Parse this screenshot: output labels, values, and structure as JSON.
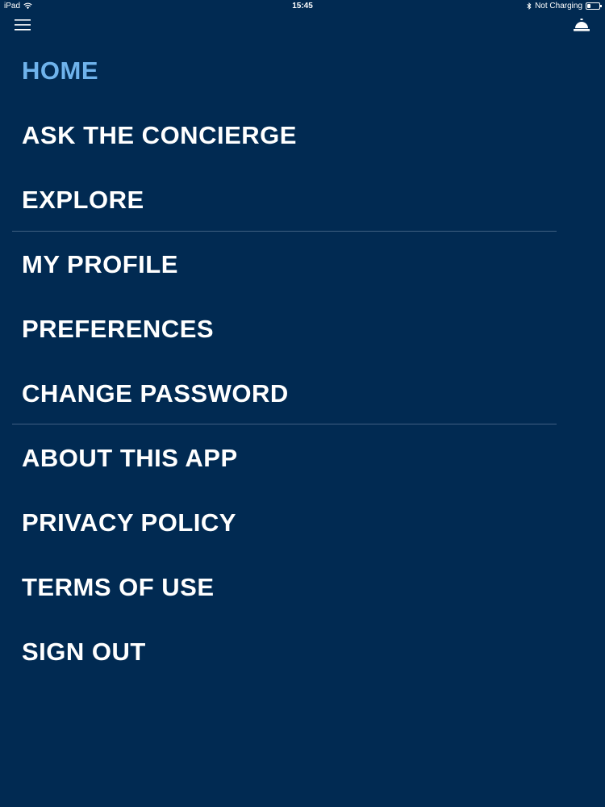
{
  "status_bar": {
    "device": "iPad",
    "time": "15:45",
    "charging": "Not Charging",
    "battery_level": 0.25
  },
  "header": {
    "menu_icon": "hamburger-menu-icon",
    "concierge_icon": "concierge-bell-icon"
  },
  "theme": {
    "background": "#012a52",
    "active": "#6fb3ec",
    "text": "#ffffff",
    "divider": "#3f5f82"
  },
  "nav": {
    "items": [
      {
        "label": "HOME",
        "active": true
      },
      {
        "label": "ASK THE CONCIERGE"
      },
      {
        "label": "EXPLORE"
      },
      {
        "label": "MY PROFILE"
      },
      {
        "label": "PREFERENCES"
      },
      {
        "label": "CHANGE PASSWORD"
      },
      {
        "label": "ABOUT THIS APP"
      },
      {
        "label": "PRIVACY POLICY"
      },
      {
        "label": "TERMS OF USE"
      },
      {
        "label": "SIGN OUT"
      }
    ]
  }
}
